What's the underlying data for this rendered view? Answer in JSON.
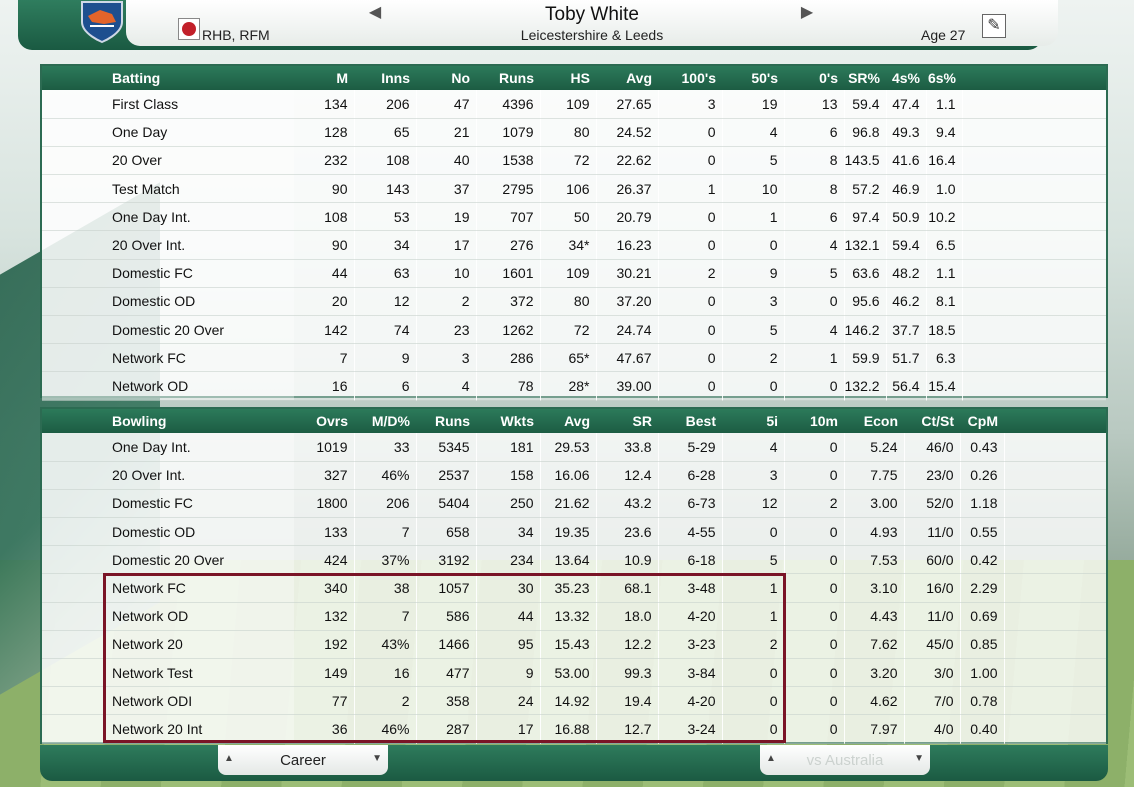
{
  "header": {
    "player_name": "Toby White",
    "team": "Leicestershire & Leeds",
    "role": "RHB, RFM",
    "age": "Age 27",
    "icons": [
      "team-crest-icon",
      "cricket-ball-icon",
      "previous-arrow-icon",
      "next-arrow-icon",
      "edit-pencil-icon"
    ]
  },
  "batting": {
    "columns": [
      "Batting",
      "M",
      "Inns",
      "No",
      "Runs",
      "HS",
      "Avg",
      "100's",
      "50's",
      "0's",
      "SR%",
      "4s%",
      "6s%"
    ],
    "rows": [
      [
        "First Class",
        "134",
        "206",
        "47",
        "4396",
        "109",
        "27.65",
        "3",
        "19",
        "13",
        "59.4",
        "47.4",
        "1.1"
      ],
      [
        "One Day",
        "128",
        "65",
        "21",
        "1079",
        "80",
        "24.52",
        "0",
        "4",
        "6",
        "96.8",
        "49.3",
        "9.4"
      ],
      [
        "20 Over",
        "232",
        "108",
        "40",
        "1538",
        "72",
        "22.62",
        "0",
        "5",
        "8",
        "143.5",
        "41.6",
        "16.4"
      ],
      [
        "Test Match",
        "90",
        "143",
        "37",
        "2795",
        "106",
        "26.37",
        "1",
        "10",
        "8",
        "57.2",
        "46.9",
        "1.0"
      ],
      [
        "One Day Int.",
        "108",
        "53",
        "19",
        "707",
        "50",
        "20.79",
        "0",
        "1",
        "6",
        "97.4",
        "50.9",
        "10.2"
      ],
      [
        "20 Over Int.",
        "90",
        "34",
        "17",
        "276",
        "34*",
        "16.23",
        "0",
        "0",
        "4",
        "132.1",
        "59.4",
        "6.5"
      ],
      [
        "Domestic FC",
        "44",
        "63",
        "10",
        "1601",
        "109",
        "30.21",
        "2",
        "9",
        "5",
        "63.6",
        "48.2",
        "1.1"
      ],
      [
        "Domestic OD",
        "20",
        "12",
        "2",
        "372",
        "80",
        "37.20",
        "0",
        "3",
        "0",
        "95.6",
        "46.2",
        "8.1"
      ],
      [
        "Domestic 20 Over",
        "142",
        "74",
        "23",
        "1262",
        "72",
        "24.74",
        "0",
        "5",
        "4",
        "146.2",
        "37.7",
        "18.5"
      ],
      [
        "Network FC",
        "7",
        "9",
        "3",
        "286",
        "65*",
        "47.67",
        "0",
        "2",
        "1",
        "59.9",
        "51.7",
        "6.3"
      ],
      [
        "Network OD",
        "16",
        "6",
        "4",
        "78",
        "28*",
        "39.00",
        "0",
        "0",
        "0",
        "132.2",
        "56.4",
        "15.4"
      ]
    ]
  },
  "bowling": {
    "columns": [
      "Bowling",
      "Ovrs",
      "M/D%",
      "Runs",
      "Wkts",
      "Avg",
      "SR",
      "Best",
      "5i",
      "10m",
      "Econ",
      "Ct/St",
      "CpM"
    ],
    "rows": [
      [
        "One Day Int.",
        "1019",
        "33",
        "5345",
        "181",
        "29.53",
        "33.8",
        "5-29",
        "4",
        "0",
        "5.24",
        "46/0",
        "0.43"
      ],
      [
        "20 Over Int.",
        "327",
        "46%",
        "2537",
        "158",
        "16.06",
        "12.4",
        "6-28",
        "3",
        "0",
        "7.75",
        "23/0",
        "0.26"
      ],
      [
        "Domestic FC",
        "1800",
        "206",
        "5404",
        "250",
        "21.62",
        "43.2",
        "6-73",
        "12",
        "2",
        "3.00",
        "52/0",
        "1.18"
      ],
      [
        "Domestic OD",
        "133",
        "7",
        "658",
        "34",
        "19.35",
        "23.6",
        "4-55",
        "0",
        "0",
        "4.93",
        "11/0",
        "0.55"
      ],
      [
        "Domestic 20 Over",
        "424",
        "37%",
        "3192",
        "234",
        "13.64",
        "10.9",
        "6-18",
        "5",
        "0",
        "7.53",
        "60/0",
        "0.42"
      ],
      [
        "Network FC",
        "340",
        "38",
        "1057",
        "30",
        "35.23",
        "68.1",
        "3-48",
        "1",
        "0",
        "3.10",
        "16/0",
        "2.29"
      ],
      [
        "Network OD",
        "132",
        "7",
        "586",
        "44",
        "13.32",
        "18.0",
        "4-20",
        "1",
        "0",
        "4.43",
        "11/0",
        "0.69"
      ],
      [
        "Network 20",
        "192",
        "43%",
        "1466",
        "95",
        "15.43",
        "12.2",
        "3-23",
        "2",
        "0",
        "7.62",
        "45/0",
        "0.85"
      ],
      [
        "Network Test",
        "149",
        "16",
        "477",
        "9",
        "53.00",
        "99.3",
        "3-84",
        "0",
        "0",
        "3.20",
        "3/0",
        "1.00"
      ],
      [
        "Network ODI",
        "77",
        "2",
        "358",
        "24",
        "14.92",
        "19.4",
        "4-20",
        "0",
        "0",
        "4.62",
        "7/0",
        "0.78"
      ],
      [
        "Network 20 Int",
        "36",
        "46%",
        "287",
        "17",
        "16.88",
        "12.7",
        "3-24",
        "0",
        "0",
        "7.97",
        "4/0",
        "0.40"
      ]
    ]
  },
  "footer": {
    "career_dropdown": "Career",
    "opponent_dropdown": "vs Australia"
  },
  "colors": {
    "header_green": "#1a5a42",
    "highlight_border": "#7a1426",
    "accent_ball": "#c2202a"
  }
}
